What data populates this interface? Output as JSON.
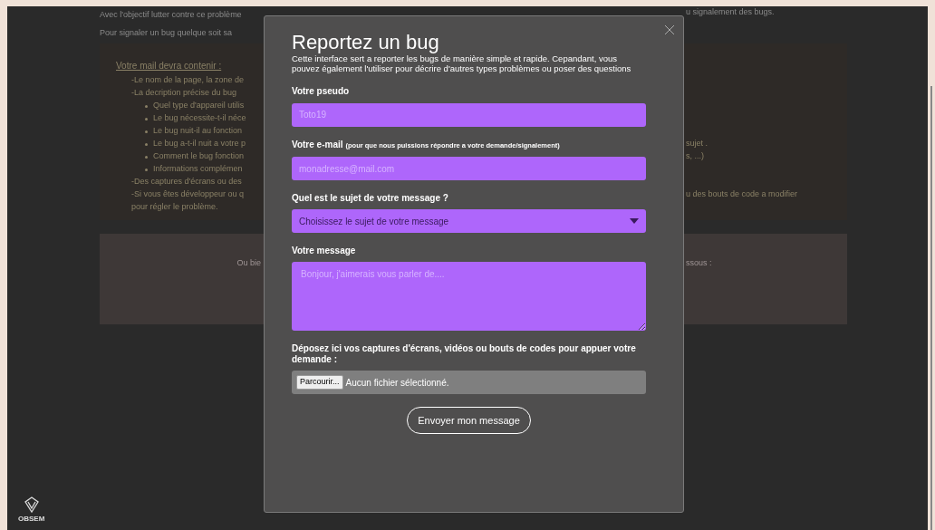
{
  "page": {
    "intro_lines": [
      {
        "left": "Avec l'objectif lutter contre ce problème",
        "right": "u signalement des bugs."
      },
      {
        "left": "Pour signaler un bug quelque soit sa"
      }
    ],
    "instructions": {
      "title": "Votre mail devra contenir :",
      "lines": [
        {
          "kind": "line",
          "left": "-Le nom de la page, la zone de"
        },
        {
          "kind": "line",
          "left": "-La decription précise du bug"
        },
        {
          "kind": "bullet",
          "left": "Quel type d'appareil utilis"
        },
        {
          "kind": "bullet",
          "left": "Le bug nécessite-t-il néce"
        },
        {
          "kind": "bullet",
          "left": "Le bug nuit-il au fonction"
        },
        {
          "kind": "bullet",
          "left": "Le bug a-t-il nuit a votre p",
          "right": "sujet ."
        },
        {
          "kind": "bullet",
          "left": "Comment le bug fonction",
          "right": "s, ...)"
        },
        {
          "kind": "bullet",
          "left": "Informations complémen"
        },
        {
          "kind": "line",
          "left": "-Des captures d'écrans ou des"
        },
        {
          "kind": "line",
          "left": "-Si vous êtes développeur ou q",
          "right": "u des bouts de code a modifier"
        },
        {
          "kind": "line",
          "left": "pour régler le problème."
        }
      ]
    },
    "alternative": {
      "left": "Ou bie",
      "right": "ssous :"
    }
  },
  "logo": {
    "name": "OBSEM"
  },
  "modal": {
    "title": "Reportez un bug",
    "description": "Cette interface sert a reporter les bugs de manière simple et rapide. Cepandant, vous pouvez également l'utiliser pour décrire d'autres types problèmes ou poser des questions",
    "fields": [
      {
        "kind": "input",
        "label": "Votre pseudo",
        "placeholder": "Toto19"
      },
      {
        "kind": "input",
        "label": "Votre e-mail",
        "note": "(pour que nous puissions répondre a votre demande/signalement)",
        "placeholder": "monadresse@mail.com"
      },
      {
        "kind": "select",
        "label": "Quel est le sujet de votre message ?",
        "value": "Choisissez le sujet de votre message"
      },
      {
        "kind": "textarea",
        "label": "Votre message",
        "placeholder": "Bonjour, j'aimerais vous parler de...."
      },
      {
        "kind": "file",
        "label": "Déposez ici vos captures d'écrans, vidéos ou bouts de codes pour appuer votre demande :",
        "button": "Parcourir...",
        "status": "Aucun fichier sélectionné."
      }
    ],
    "submit": "Envoyer mon message"
  }
}
